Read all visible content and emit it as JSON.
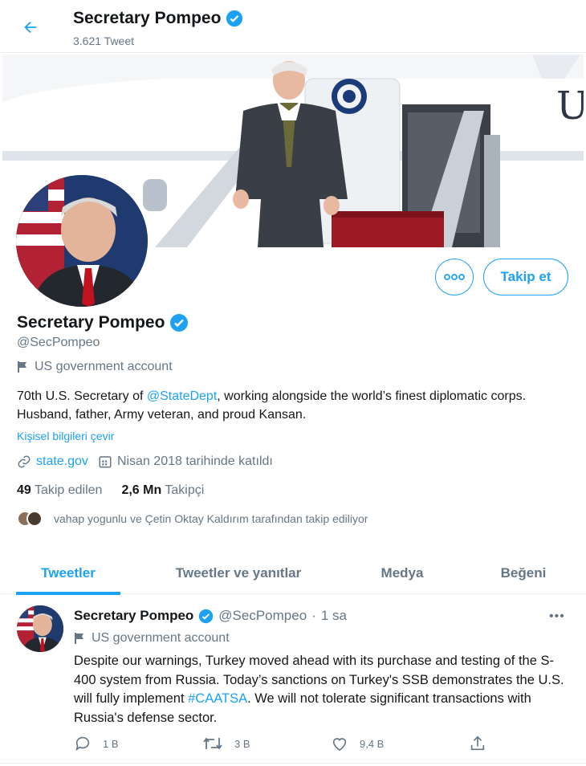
{
  "header": {
    "title": "Secretary Pompeo",
    "tweet_count": "3.621 Tweet"
  },
  "icons": {
    "back": "arrow-left-icon",
    "verified": "verified-badge-icon",
    "flag": "flag-icon",
    "link": "link-icon",
    "calendar": "calendar-icon",
    "more": "more-dots-icon"
  },
  "profile": {
    "name": "Secretary Pompeo",
    "handle": "@SecPompeo",
    "gov_label": "US government account",
    "bio_before": "70th U.S. Secretary of ",
    "bio_mention": "@StateDept",
    "bio_after": ", working alongside the world’s finest diplomatic corps. Husband, father, Army veteran, and proud Kansan.",
    "translate": "Kişisel bilgileri çevir",
    "website": "state.gov",
    "joined": "Nisan 2018 tarihinde katıldı",
    "following_count": "49",
    "following_label": "Takip edilen",
    "followers_count": "2,6 Mn",
    "followers_label": "Takipçi",
    "followed_by": "vahap yogunlu ve Çetin Oktay Kaldırım tarafından takip ediliyor",
    "follow_button": "Takip et",
    "more_button": "•••"
  },
  "tabs": [
    {
      "label": "Tweetler",
      "active": true
    },
    {
      "label": "Tweetler ve yanıtlar",
      "active": false
    },
    {
      "label": "Medya",
      "active": false
    },
    {
      "label": "Beğeni",
      "active": false
    }
  ],
  "tweet": {
    "name": "Secretary Pompeo",
    "handle": "@SecPompeo",
    "separator": "·",
    "time": "1 sa",
    "gov_label": "US government account",
    "text_before": "Despite our warnings, Turkey moved ahead with its purchase and testing of the S-400 system from Russia. Today’s sanctions on Turkey's SSB demonstrates the U.S. will fully implement ",
    "hashtag": "#CAATSA",
    "text_after": ". We will not tolerate significant transactions with Russia's defense sector.",
    "more": "•••",
    "replies": "1 B",
    "retweets": "3 B",
    "likes": "9,4 B"
  },
  "colors": {
    "accent": "#1da1f2",
    "secondary_text": "#657786",
    "primary_text": "#14171a"
  }
}
